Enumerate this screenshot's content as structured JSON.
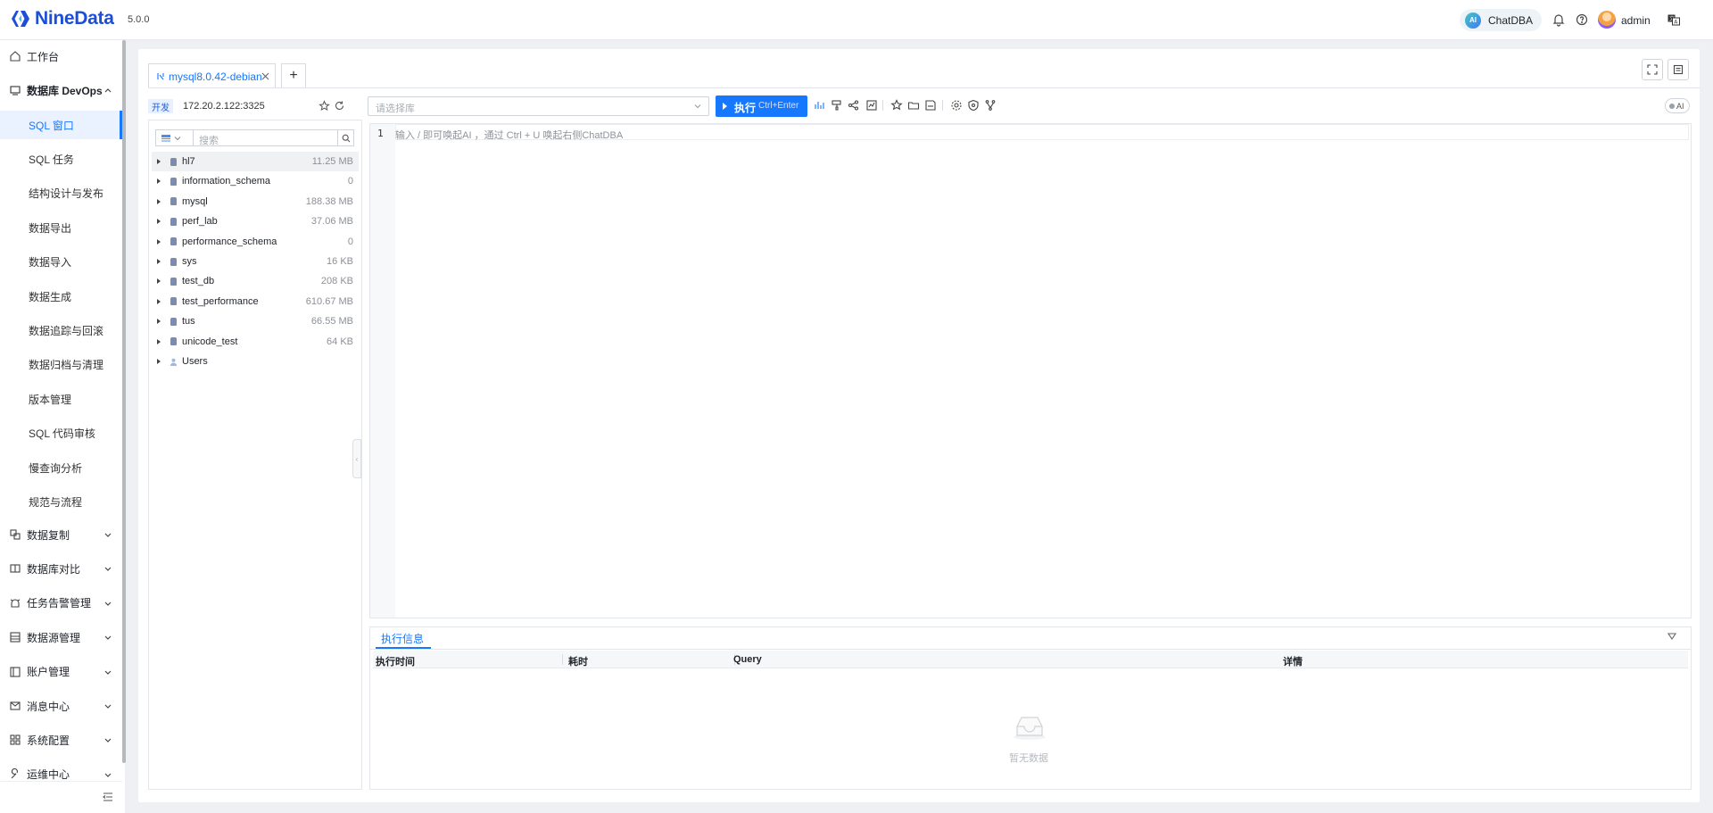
{
  "header": {
    "brand": "NineData",
    "version": "5.0.0",
    "chatdba_label": "ChatDBA",
    "chatdba_badge": "AI",
    "username": "admin"
  },
  "sidebar": {
    "workbench": "工作台",
    "devops_group": "数据库 DevOps",
    "devops_items": [
      {
        "label": "SQL 窗口",
        "active": true
      },
      {
        "label": "SQL 任务"
      },
      {
        "label": "结构设计与发布"
      },
      {
        "label": "数据导出"
      },
      {
        "label": "数据导入"
      },
      {
        "label": "数据生成"
      },
      {
        "label": "数据追踪与回滚"
      },
      {
        "label": "数据归档与清理"
      },
      {
        "label": "版本管理"
      },
      {
        "label": "SQL 代码审核"
      },
      {
        "label": "慢查询分析"
      },
      {
        "label": "规范与流程"
      }
    ],
    "groups": [
      {
        "label": "数据复制",
        "icon": "replication-icon"
      },
      {
        "label": "数据库对比",
        "icon": "compare-icon"
      },
      {
        "label": "任务告警管理",
        "icon": "alarm-icon"
      },
      {
        "label": "数据源管理",
        "icon": "datasource-icon"
      },
      {
        "label": "账户管理",
        "icon": "account-icon"
      },
      {
        "label": "消息中心",
        "icon": "mail-icon"
      },
      {
        "label": "系统配置",
        "icon": "grid-icon"
      },
      {
        "label": "运维中心",
        "icon": "wrench-icon"
      }
    ]
  },
  "tabs": {
    "active_label": "mysql8.0.42-debian",
    "add_label": "+"
  },
  "connection": {
    "env_tag": "开发",
    "address": "172.20.2.122:3325"
  },
  "tree": {
    "search_placeholder": "搜索",
    "databases": [
      {
        "name": "hl7",
        "size": "11.25 MB"
      },
      {
        "name": "information_schema",
        "size": "0"
      },
      {
        "name": "mysql",
        "size": "188.38 MB"
      },
      {
        "name": "perf_lab",
        "size": "37.06 MB"
      },
      {
        "name": "performance_schema",
        "size": "0"
      },
      {
        "name": "sys",
        "size": "16 KB"
      },
      {
        "name": "test_db",
        "size": "208 KB"
      },
      {
        "name": "test_performance",
        "size": "610.67 MB"
      },
      {
        "name": "tus",
        "size": "66.55 MB"
      },
      {
        "name": "unicode_test",
        "size": "64 KB"
      }
    ],
    "users_label": "Users"
  },
  "toolbar": {
    "db_select_placeholder": "请选择库",
    "run_label": "执行",
    "run_shortcut": "Ctrl+Enter",
    "ai_toggle_label": "AI"
  },
  "editor": {
    "line_number": "1",
    "hint": "输入 / 即可唤起AI ，通过 Ctrl + U 唤起右侧ChatDBA"
  },
  "results": {
    "tab_label": "执行信息",
    "columns": [
      "执行时间",
      "耗时",
      "Query",
      "详情"
    ],
    "empty_text": "暂无数据"
  },
  "colors": {
    "accent": "#1677ff",
    "brand": "#1d4ed8"
  }
}
